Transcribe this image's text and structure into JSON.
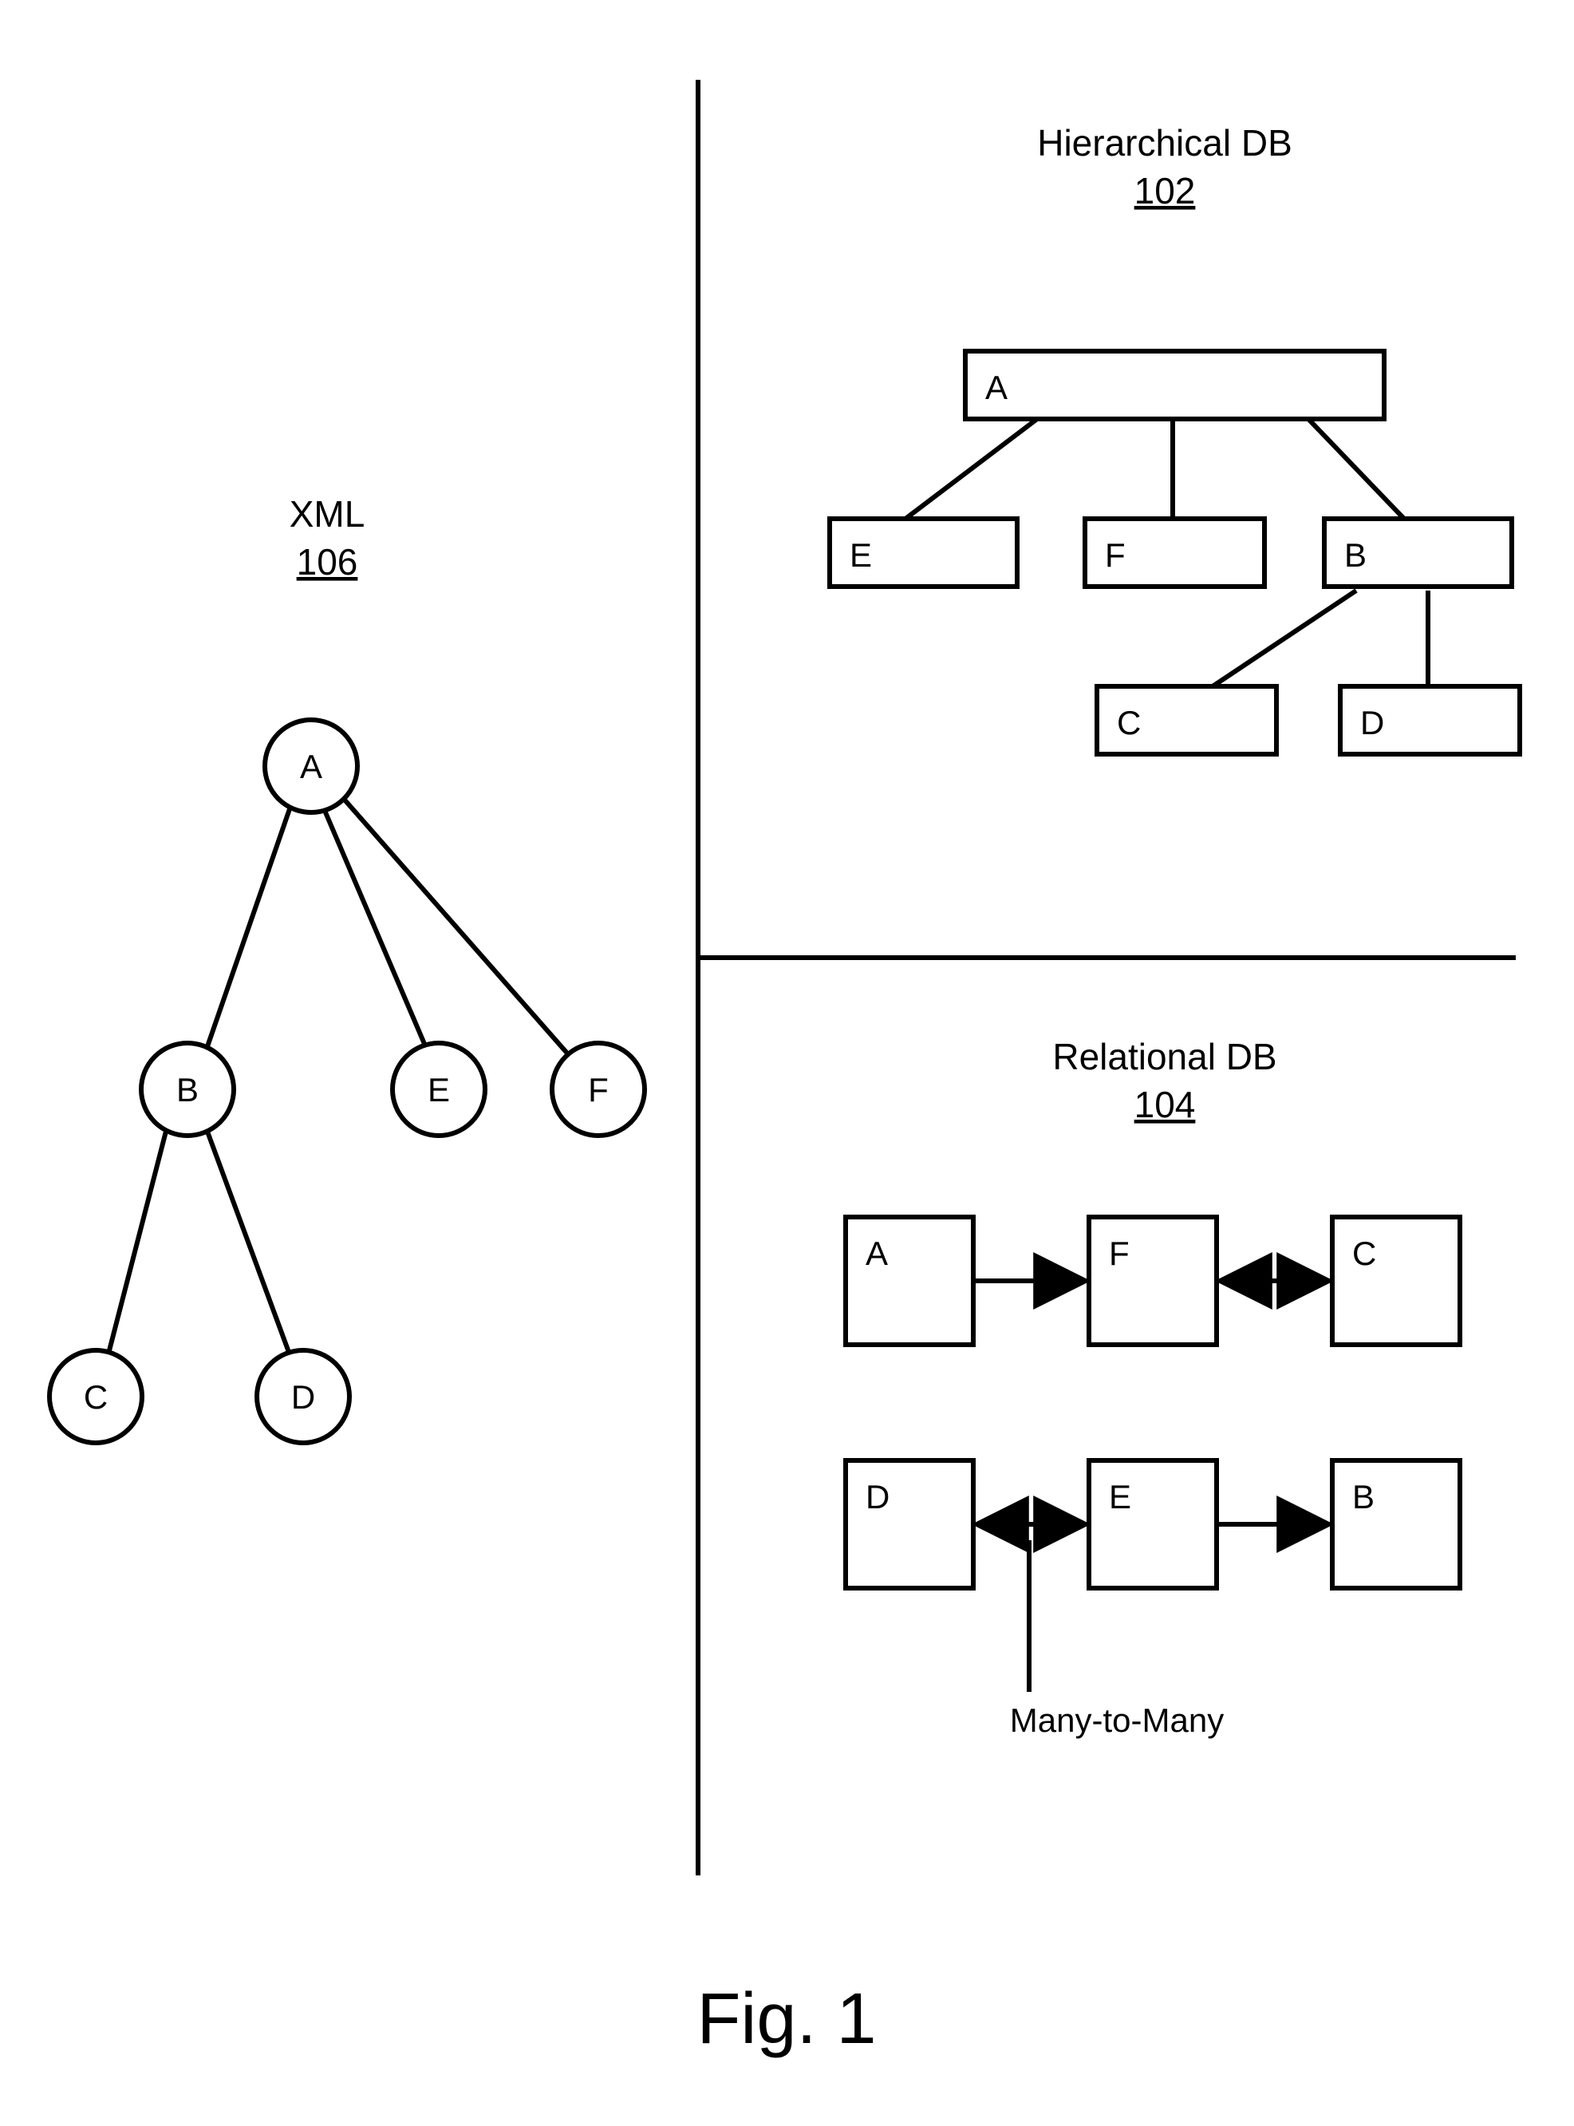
{
  "fig_caption": "Fig. 1",
  "xml": {
    "title": "XML",
    "ref": "106",
    "A": "A",
    "B": "B",
    "C": "C",
    "D": "D",
    "E": "E",
    "F": "F"
  },
  "hier": {
    "title": "Hierarchical DB",
    "ref": "102",
    "A": "A",
    "B": "B",
    "C": "C",
    "D": "D",
    "E": "E",
    "F": "F"
  },
  "rel": {
    "title": "Relational DB",
    "ref": "104",
    "A": "A",
    "B": "B",
    "C": "C",
    "D": "D",
    "E": "E",
    "F": "F",
    "m2m": "Many-to-Many"
  },
  "chart_data": {
    "type": "diagram",
    "title": "Fig. 1",
    "components": [
      {
        "name": "XML",
        "ref": "106",
        "structure": "tree",
        "node_shape": "circle",
        "nodes": [
          "A",
          "B",
          "C",
          "D",
          "E",
          "F"
        ],
        "edges": [
          [
            "A",
            "B"
          ],
          [
            "A",
            "E"
          ],
          [
            "A",
            "F"
          ],
          [
            "B",
            "C"
          ],
          [
            "B",
            "D"
          ]
        ]
      },
      {
        "name": "Hierarchical DB",
        "ref": "102",
        "structure": "tree",
        "node_shape": "rectangle",
        "nodes": [
          "A",
          "B",
          "C",
          "D",
          "E",
          "F"
        ],
        "edges": [
          [
            "A",
            "E"
          ],
          [
            "A",
            "F"
          ],
          [
            "A",
            "B"
          ],
          [
            "B",
            "C"
          ],
          [
            "B",
            "D"
          ]
        ]
      },
      {
        "name": "Relational DB",
        "ref": "104",
        "structure": "graph",
        "node_shape": "square",
        "nodes": [
          "A",
          "B",
          "C",
          "D",
          "E",
          "F"
        ],
        "edges": [
          {
            "from": "A",
            "to": "F",
            "type": "one-way"
          },
          {
            "from": "F",
            "to": "C",
            "type": "many-to-many"
          },
          {
            "from": "D",
            "to": "E",
            "type": "many-to-many",
            "label": "Many-to-Many"
          },
          {
            "from": "E",
            "to": "B",
            "type": "one-way"
          }
        ]
      }
    ]
  }
}
